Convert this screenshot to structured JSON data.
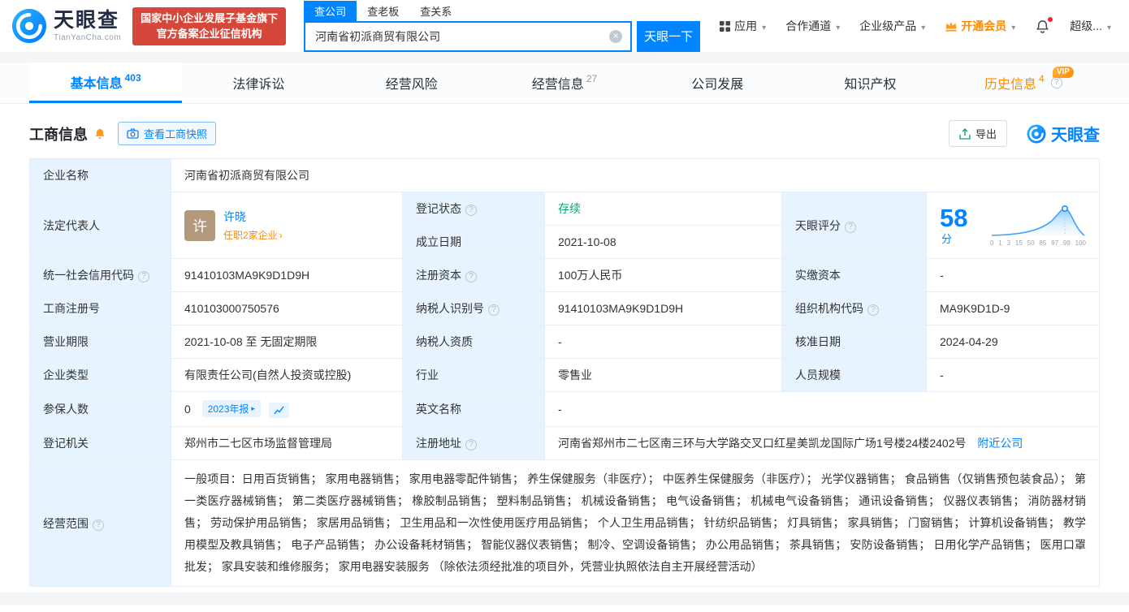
{
  "colors": {
    "accent_blue": "#0084ff",
    "status_green": "#00a870",
    "vip_orange": "#ff8b03",
    "badge_red": "#d6473b",
    "avatar_brown": "#b2997b",
    "label_cell_blue": "#e7f3fe"
  },
  "header": {
    "logo_cn": "天眼查",
    "logo_en": "TianYanCha.com",
    "badge_line1": "国家中小企业发展子基金旗下",
    "badge_line2": "官方备案企业征信机构",
    "search_tabs": {
      "company": "查公司",
      "boss": "查老板",
      "relation": "查关系"
    },
    "search_value": "河南省初派商贸有限公司",
    "search_button": "天眼一下",
    "nav_apps": "应用",
    "nav_cooperation": "合作通道",
    "nav_enterprise": "企业级产品",
    "nav_vip": "开通会员",
    "nav_super": "超级..."
  },
  "tabs": {
    "basic": {
      "label": "基本信息",
      "count": "403"
    },
    "legal": {
      "label": "法律诉讼"
    },
    "risk": {
      "label": "经营风险"
    },
    "operation": {
      "label": "经营信息",
      "count": "27"
    },
    "development": {
      "label": "公司发展"
    },
    "ip": {
      "label": "知识产权"
    },
    "history": {
      "label": "历史信息",
      "count": "4",
      "vip_tag": "VIP"
    }
  },
  "section": {
    "title": "工商信息",
    "snapshot_button": "查看工商快照",
    "export_button": "导出",
    "brand": "天眼查"
  },
  "info": {
    "name": {
      "label": "企业名称",
      "value": "河南省初派商贸有限公司"
    },
    "legal_rep": {
      "label": "法定代表人",
      "avatar_char": "许",
      "name": "许晓",
      "jobs": "任职2家企业"
    },
    "reg_status": {
      "label": "登记状态",
      "value": "存续"
    },
    "establish_date": {
      "label": "成立日期",
      "value": "2021-10-08"
    },
    "score": {
      "label": "天眼评分",
      "value": "58",
      "unit": "分",
      "axis": [
        "0",
        "1",
        "3",
        "15",
        "50",
        "85",
        "97",
        "99",
        "100"
      ]
    },
    "credit_code": {
      "label": "统一社会信用代码",
      "value": "91410103MA9K9D1D9H"
    },
    "reg_capital": {
      "label": "注册资本",
      "value": "100万人民币"
    },
    "paid_capital": {
      "label": "实缴资本",
      "value": "-"
    },
    "reg_number": {
      "label": "工商注册号",
      "value": "410103000750576"
    },
    "taxpayer_id": {
      "label": "纳税人识别号",
      "value": "91410103MA9K9D1D9H"
    },
    "org_code": {
      "label": "组织机构代码",
      "value": "MA9K9D1D-9"
    },
    "business_term": {
      "label": "营业期限",
      "value": "2021-10-08 至 无固定期限"
    },
    "taxpayer_quality": {
      "label": "纳税人资质",
      "value": "-"
    },
    "approval_date": {
      "label": "核准日期",
      "value": "2024-04-29"
    },
    "company_type": {
      "label": "企业类型",
      "value": "有限责任公司(自然人投资或控股)"
    },
    "industry": {
      "label": "行业",
      "value": "零售业"
    },
    "staff_size": {
      "label": "人员规模",
      "value": "-"
    },
    "insured": {
      "label": "参保人数",
      "value": "0",
      "report": "2023年报"
    },
    "english_name": {
      "label": "英文名称",
      "value": "-"
    },
    "authority": {
      "label": "登记机关",
      "value": "郑州市二七区市场监督管理局"
    },
    "address": {
      "label": "注册地址",
      "value": "河南省郑州市二七区南三环与大学路交叉口红星美凯龙国际广场1号楼24楼2402号",
      "nearby": "附近公司"
    },
    "scope": {
      "label": "经营范围",
      "value": "一般项目：日用百货销售； 家用电器销售； 家用电器零配件销售； 养生保健服务（非医疗）； 中医养生保健服务（非医疗）； 光学仪器销售； 食品销售（仅销售预包装食品）； 第一类医疗器械销售； 第二类医疗器械销售； 橡胶制品销售； 塑料制品销售； 机械设备销售； 电气设备销售； 机械电气设备销售； 通讯设备销售； 仪器仪表销售； 消防器材销售； 劳动保护用品销售； 家居用品销售； 卫生用品和一次性使用医疗用品销售； 个人卫生用品销售； 针纺织品销售； 灯具销售； 家具销售； 门窗销售； 计算机设备销售； 教学用模型及教具销售； 电子产品销售； 办公设备耗材销售； 智能仪器仪表销售； 制冷、空调设备销售； 办公用品销售； 茶具销售； 安防设备销售； 日用化学产品销售； 医用口罩批发； 家具安装和维修服务； 家用电器安装服务 （除依法须经批准的项目外，凭营业执照依法自主开展经营活动）"
    }
  }
}
